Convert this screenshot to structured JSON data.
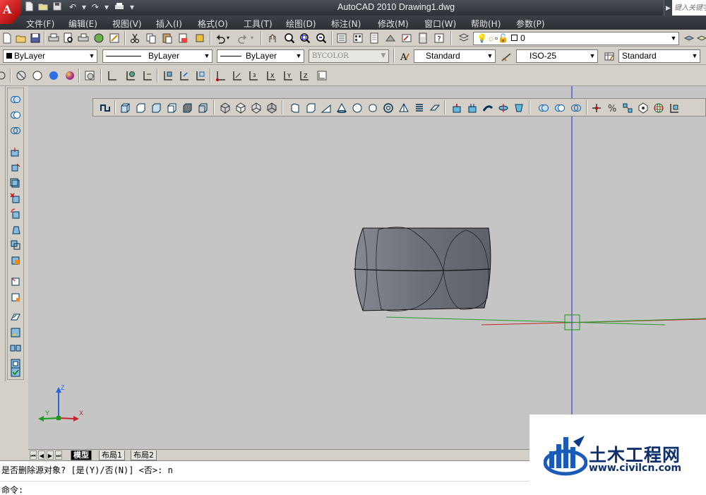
{
  "window": {
    "title": "AutoCAD 2010     Drawing1.dwg",
    "help_search_placeholder": "键入关键字"
  },
  "menu": [
    "文件(F)",
    "编辑(E)",
    "视图(V)",
    "插入(I)",
    "格式(O)",
    "工具(T)",
    "绘图(D)",
    "标注(N)",
    "修改(M)",
    "窗口(W)",
    "帮助(H)",
    "参数(P)"
  ],
  "layer": {
    "current": "0"
  },
  "properties": {
    "color": "ByLayer",
    "linetype": "ByLayer",
    "lineweight": "ByLayer",
    "plotstyle": "BYCOLOR"
  },
  "styles": {
    "text_style": "Standard",
    "dim_style": "ISO-25",
    "table_style": "Standard"
  },
  "ucs_icon": {
    "z": "Z",
    "y": "Y",
    "x": "X"
  },
  "tabs": [
    "模型",
    "布局1",
    "布局2"
  ],
  "active_tab": "模型",
  "command": {
    "history": "是否删除源对象? [是(Y)/否(N)] <否>: n",
    "prompt": "命令:"
  },
  "watermark": {
    "title": "土木工程网",
    "url": "www.civilcn.com"
  },
  "colors": {
    "canvas": "#c5c5c5",
    "title_bar": "#3a3e45",
    "solid_face": "#686b74",
    "crosshair": "#2828c8",
    "watermark_text": "#0d2f6e"
  }
}
